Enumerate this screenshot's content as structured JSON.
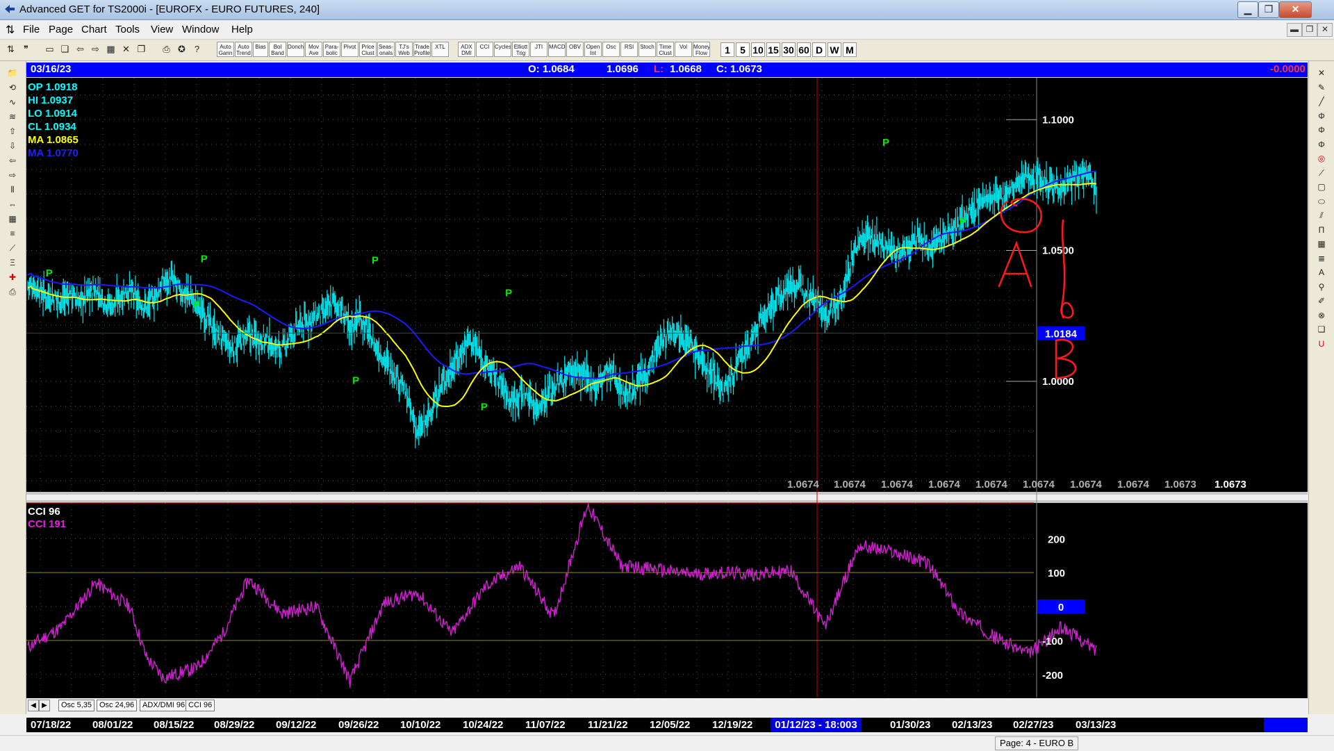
{
  "window": {
    "title": "Advanced GET for TS2000i - [EUROFX - EURO FUTURES, 240]",
    "btn_min": "▁",
    "btn_max": "❐",
    "btn_close": "✕"
  },
  "menu": [
    "File",
    "Page",
    "Chart",
    "Tools",
    "View",
    "Window",
    "Help"
  ],
  "mdi_buttons": [
    "▬",
    "❐",
    "✕"
  ],
  "toolbar": {
    "study_buttons": [
      "Auto Gann",
      "Auto Trend",
      "Bias",
      "Bol Band",
      "Donch",
      "Mov Ave",
      "Para- bolic",
      "Pivot",
      "Price Clust",
      "Seas- onals",
      "TJ's Web",
      "Trade Profile",
      "XTL",
      "ADX DMI",
      "CCI",
      "Cycles",
      "Elliott Trig",
      "JTI",
      "MACD",
      "OBV",
      "Open Int",
      "Osc",
      "RSI",
      "Stoch",
      "Time Clust",
      "Vol",
      "Money Flow"
    ],
    "interval_buttons": [
      "1",
      "5",
      "10",
      "15",
      "30",
      "60",
      "D",
      "W",
      "M"
    ]
  },
  "info_bar": {
    "date": "03/16/23",
    "open": "O: 1.0684",
    "high": "1.0696",
    "low_label": "L:",
    "low": "1.0668",
    "close": "C: 1.0673",
    "change": "-0.0000"
  },
  "price_panel": {
    "legend": [
      {
        "label": "OP",
        "value": "1.0918",
        "color": "#00ffff"
      },
      {
        "label": "HI",
        "value": "1.0937",
        "color": "#00ffff"
      },
      {
        "label": "LO",
        "value": "1.0914",
        "color": "#00ffff"
      },
      {
        "label": "CL",
        "value": "1.0934",
        "color": "#00ffff"
      },
      {
        "label": "MA",
        "value": "1.0865",
        "color": "#ffff00"
      },
      {
        "label": "MA",
        "value": "1.0770",
        "color": "#2020ff"
      }
    ],
    "y_ticks": [
      "1.1000",
      "1.0500",
      "1.0000"
    ],
    "crosshair_price": "1.0184",
    "bottom_values": [
      "1.0674",
      "1.0674",
      "1.0674",
      "1.0674",
      "1.0674",
      "1.0674",
      "1.0674",
      "1.0674",
      "1.0673",
      "1.0673"
    ],
    "pivot_marker": "P",
    "annotations": [
      "A",
      "B"
    ]
  },
  "cci_panel": {
    "legend": [
      {
        "label": "CCI 96",
        "color": "#ffffff"
      },
      {
        "label": "CCI  191",
        "color": "#e020e0"
      }
    ],
    "y_ticks": [
      "200",
      "100",
      "0",
      "-100",
      "-200"
    ]
  },
  "tabs": [
    "Osc 5,35",
    "Osc 24,96",
    "ADX/DMI 96",
    "CCI 96"
  ],
  "date_axis": {
    "labels": [
      "07/18/22",
      "08/01/22",
      "08/15/22",
      "08/29/22",
      "09/12/22",
      "09/26/22",
      "10/10/22",
      "10/24/22",
      "11/07/22",
      "11/21/22",
      "12/05/22",
      "12/19/22",
      "01/30/23",
      "02/13/23",
      "02/27/23",
      "03/13/23"
    ],
    "selected": "01/12/23 - 18:00",
    "selected_tail": "3"
  },
  "status": {
    "page": "Page: 4 - EURO B"
  },
  "colors": {
    "bars": "#00e5ee",
    "ma_fast": "#ffff00",
    "ma_slow": "#1a1aff",
    "cci": "#cc22cc",
    "pivot": "#00ee00",
    "crosshair": "#cc0000",
    "annotation": "#ff1a1a",
    "grid": "#5a5a5a"
  },
  "chart_data": {
    "type": "line",
    "series": [
      {
        "name": "MA",
        "values": []
      },
      {
        "name": "MA",
        "values": []
      }
    ],
    "price_series_knots": {
      "x": [
        0,
        10,
        20,
        30,
        40,
        50,
        60,
        70,
        80,
        90,
        100,
        110,
        120,
        130,
        140,
        150,
        160,
        170,
        180,
        190,
        200,
        210,
        220,
        230,
        240,
        250,
        260,
        270,
        280,
        290,
        300,
        310,
        320,
        330,
        340,
        350,
        360,
        370,
        380,
        390,
        400,
        410,
        420,
        430,
        440,
        450,
        460,
        470,
        480,
        490,
        500,
        510,
        520,
        530,
        540,
        550,
        560,
        570,
        580,
        590,
        600,
        610,
        620,
        630,
        640,
        650,
        660,
        670,
        680,
        690,
        700,
        710,
        720,
        730,
        740,
        750,
        760,
        770,
        780,
        790,
        800,
        810,
        820,
        830,
        840,
        850,
        860,
        870,
        880,
        890,
        900,
        910,
        920,
        930,
        940,
        950,
        960,
        970,
        980,
        990,
        1000,
        1010,
        1020,
        1030,
        1040,
        1050,
        1060,
        1070,
        1080,
        1090,
        1100,
        1110,
        1120,
        1130,
        1140,
        1150,
        1160,
        1170,
        1180,
        1190,
        1200,
        1210,
        1220,
        1230,
        1240,
        1250,
        1260
      ],
      "close": [
        1.037,
        1.036,
        1.033,
        1.032,
        1.031,
        1.034,
        1.03,
        1.033,
        1.035,
        1.031,
        1.029,
        1.033,
        1.035,
        1.03,
        1.029,
        1.032,
        1.038,
        1.039,
        1.034,
        1.033,
        1.029,
        1.025,
        1.019,
        1.016,
        1.012,
        1.015,
        1.018,
        1.016,
        1.016,
        1.013,
        1.012,
        1.018,
        1.021,
        1.023,
        1.025,
        1.026,
        1.031,
        1.027,
        1.02,
        1.025,
        1.02,
        1.013,
        1.009,
        1.004,
        1.0,
        0.99,
        0.98,
        0.985,
        0.992,
        1.0,
        1.005,
        1.01,
        1.017,
        1.012,
        1.006,
        1.003,
        0.998,
        0.992,
        0.996,
        0.994,
        0.99,
        0.994,
        0.998,
        1.0,
        1.005,
        1.003,
        1.001,
        0.998,
        1.003,
        1.004,
        0.996,
        0.995,
        0.999,
        1.004,
        1.011,
        1.016,
        1.021,
        1.019,
        1.015,
        1.01,
        1.005,
        1.003,
        0.996,
        1.002,
        1.008,
        1.013,
        1.02,
        1.026,
        1.03,
        1.034,
        1.037,
        1.036,
        1.035,
        1.033,
        1.024,
        1.028,
        1.032,
        1.045,
        1.054,
        1.056,
        1.054,
        1.051,
        1.05,
        1.049,
        1.052,
        1.055,
        1.051,
        1.054,
        1.056,
        1.058,
        1.061,
        1.065,
        1.067,
        1.07,
        1.069,
        1.071,
        1.073,
        1.076,
        1.079,
        1.078,
        1.077,
        1.075,
        1.074,
        1.076,
        1.079,
        1.081,
        1.075
      ]
    },
    "cci_knots": {
      "x": [
        0,
        40,
        80,
        120,
        140,
        160,
        200,
        230,
        260,
        300,
        340,
        380,
        420,
        460,
        500,
        540,
        580,
        620,
        660,
        700,
        740,
        780,
        820,
        860,
        900,
        940,
        980,
        1020,
        1060,
        1100,
        1140,
        1180,
        1220,
        1260
      ],
      "values": [
        -120,
        -60,
        70,
        0,
        -150,
        -210,
        -180,
        -80,
        80,
        -20,
        0,
        -220,
        10,
        40,
        -80,
        60,
        120,
        -30,
        300,
        120,
        110,
        95,
        100,
        95,
        105,
        -60,
        180,
        160,
        130,
        -20,
        -90,
        -140,
        -60,
        -130
      ]
    },
    "ylim_price": [
      0.958,
      1.116
    ],
    "ylim_cci": [
      -270,
      305
    ],
    "xlabel": "",
    "ylabel": ""
  }
}
